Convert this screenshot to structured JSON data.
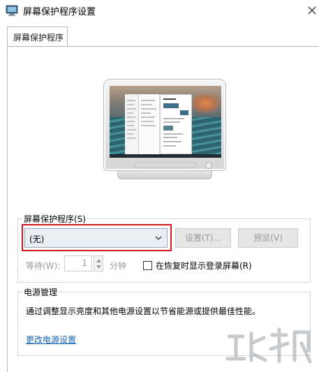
{
  "window": {
    "title": "屏幕保护程序设置"
  },
  "tabs": [
    {
      "label": "屏幕保护程序"
    }
  ],
  "screensaver": {
    "group_label": "屏幕保护程序(S)",
    "selected": "(无)",
    "settings_label": "设置(T)...",
    "preview_label": "预览(V)",
    "wait_label": "等待(W):",
    "wait_value": "1",
    "wait_unit": "分钟",
    "resume_label": "在恢复时显示登录屏幕(R)",
    "resume_checked": false
  },
  "power": {
    "group_label": "电源管理",
    "description": "通过调整显示亮度和其他电源设置以节省能源或提供最佳性能。",
    "link_label": "更改电源设置"
  },
  "colors": {
    "highlight": "#d4171c",
    "link": "#1463b8",
    "disabled_text": "#9a9a9a"
  },
  "icons": {
    "app": "screensaver-monitor-icon",
    "close": "close-icon",
    "dropdown": "chevron-down-icon"
  }
}
